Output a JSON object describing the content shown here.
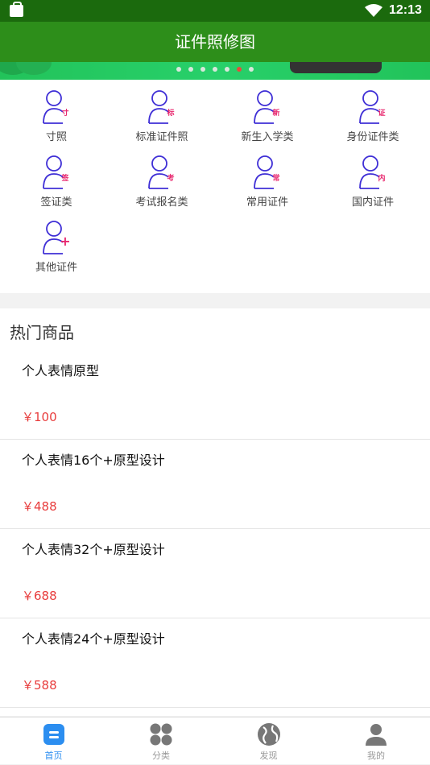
{
  "status": {
    "time": "12:13"
  },
  "header": {
    "title": "证件照修图"
  },
  "banner": {
    "dot_count": 7,
    "active_dot": 5
  },
  "categories": [
    {
      "label": "寸照",
      "badge": "寸"
    },
    {
      "label": "标准证件照",
      "badge": "标"
    },
    {
      "label": "新生入学类",
      "badge": "新"
    },
    {
      "label": "身份证件类",
      "badge": "证"
    },
    {
      "label": "签证类",
      "badge": "签"
    },
    {
      "label": "考试报名类",
      "badge": "考"
    },
    {
      "label": "常用证件",
      "badge": "常"
    },
    {
      "label": "国内证件",
      "badge": "内"
    },
    {
      "label": "其他证件",
      "badge": "+"
    }
  ],
  "hot": {
    "title": "热门商品",
    "items": [
      {
        "name": "个人表情原型",
        "price": "￥100"
      },
      {
        "name": "个人表情16个+原型设计",
        "price": "￥488"
      },
      {
        "name": "个人表情32个+原型设计",
        "price": "￥688"
      },
      {
        "name": "个人表情24个+原型设计",
        "price": "￥588"
      }
    ]
  },
  "tabs": [
    {
      "label": "首页",
      "icon": "home-icon",
      "active": true
    },
    {
      "label": "分类",
      "icon": "category-icon",
      "active": false
    },
    {
      "label": "发现",
      "icon": "globe-icon",
      "active": false
    },
    {
      "label": "我的",
      "icon": "profile-icon",
      "active": false
    }
  ],
  "colors": {
    "appbar": "#2d8e1a",
    "statusbar": "#1b6a0d",
    "price": "#e83c3c",
    "icon_stroke": "#3f2fd6",
    "badge": "#e8286e",
    "tab_active": "#2c8ef0"
  }
}
